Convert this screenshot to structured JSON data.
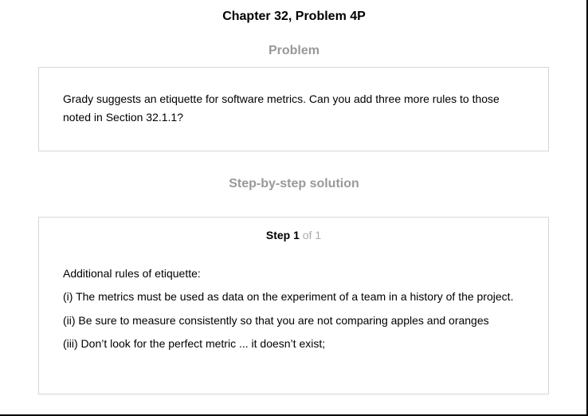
{
  "chapter_title": "Chapter 32, Problem 4P",
  "problem": {
    "heading": "Problem",
    "text": "Grady suggests an etiquette for software metrics. Can you add three more rules to those noted in Section 32.1.1?"
  },
  "solution": {
    "heading": "Step-by-step solution",
    "step_label": "Step 1",
    "step_count": "of 1",
    "lines": [
      "Additional rules of etiquette:",
      "(i) The metrics must be used as data on the experiment of a team in a history of the project.",
      "(ii) Be sure to measure consistently so that you are not comparing apples and oranges",
      "(iii) Don’t look for the perfect metric ... it doesn’t exist;"
    ]
  }
}
